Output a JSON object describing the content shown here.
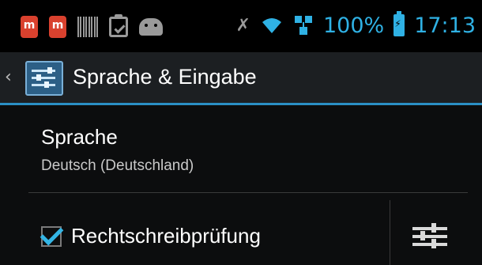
{
  "status_bar": {
    "icons_left": [
      "app-notification-icon",
      "app-notification-icon",
      "barcode-icon",
      "clipboard-check-icon",
      "android-icon"
    ],
    "icons_right": [
      "mute-icon",
      "wifi-icon",
      "network-sync-icon"
    ],
    "battery_percent": "100%",
    "time": "17:13",
    "accent_color": "#2fb1e4"
  },
  "action_bar": {
    "title": "Sprache & Eingabe",
    "icon": "settings-sliders-icon",
    "up_icon": "chevron-left-icon",
    "divider_color": "#2b8fc4"
  },
  "settings": {
    "language": {
      "title": "Sprache",
      "summary": "Deutsch (Deutschland)"
    },
    "spell_check": {
      "label": "Rechtschreibprüfung",
      "checked": true,
      "settings_icon": "sliders-icon"
    }
  }
}
